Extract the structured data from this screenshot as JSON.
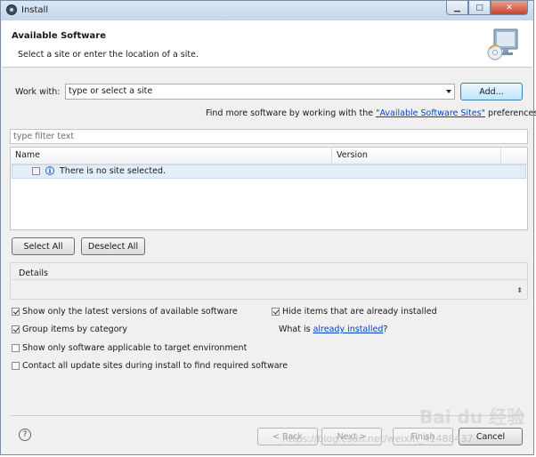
{
  "window": {
    "title": "Install"
  },
  "header": {
    "title": "Available Software",
    "description": "Select a site or enter the location of a site."
  },
  "work_with": {
    "label": "Work with:",
    "value": "type or select a site",
    "add_button": "Add...",
    "find_more_prefix": "Find more software by working with the ",
    "find_more_link": "\"Available Software Sites\"",
    "find_more_suffix": " preferences."
  },
  "filter": {
    "placeholder": "type filter text"
  },
  "table": {
    "columns": [
      "Name",
      "Version"
    ],
    "rows": [
      {
        "name": "There is no site selected.",
        "checked": false
      }
    ]
  },
  "selection_buttons": {
    "select_all": "Select All",
    "deselect_all": "Deselect All"
  },
  "details": {
    "label": "Details"
  },
  "options": {
    "latest_versions": {
      "label": "Show only the latest versions of available software",
      "checked": true
    },
    "hide_installed": {
      "label": "Hide items that are already installed",
      "checked": true
    },
    "group_by_category": {
      "label": "Group items by category",
      "checked": true
    },
    "what_is_prefix": "What is ",
    "what_is_link": "already installed",
    "what_is_suffix": "?",
    "target_env": {
      "label": "Show only software applicable to target environment",
      "checked": false
    },
    "contact_sites": {
      "label": "Contact all update sites during install to find required software",
      "checked": false
    }
  },
  "footer": {
    "back": "< Back",
    "next": "Next >",
    "finish": "Finish",
    "cancel": "Cancel"
  },
  "watermark": {
    "url": "https://blog.csdn.net/weixin_41488437",
    "brand": "Bai du 经验"
  }
}
